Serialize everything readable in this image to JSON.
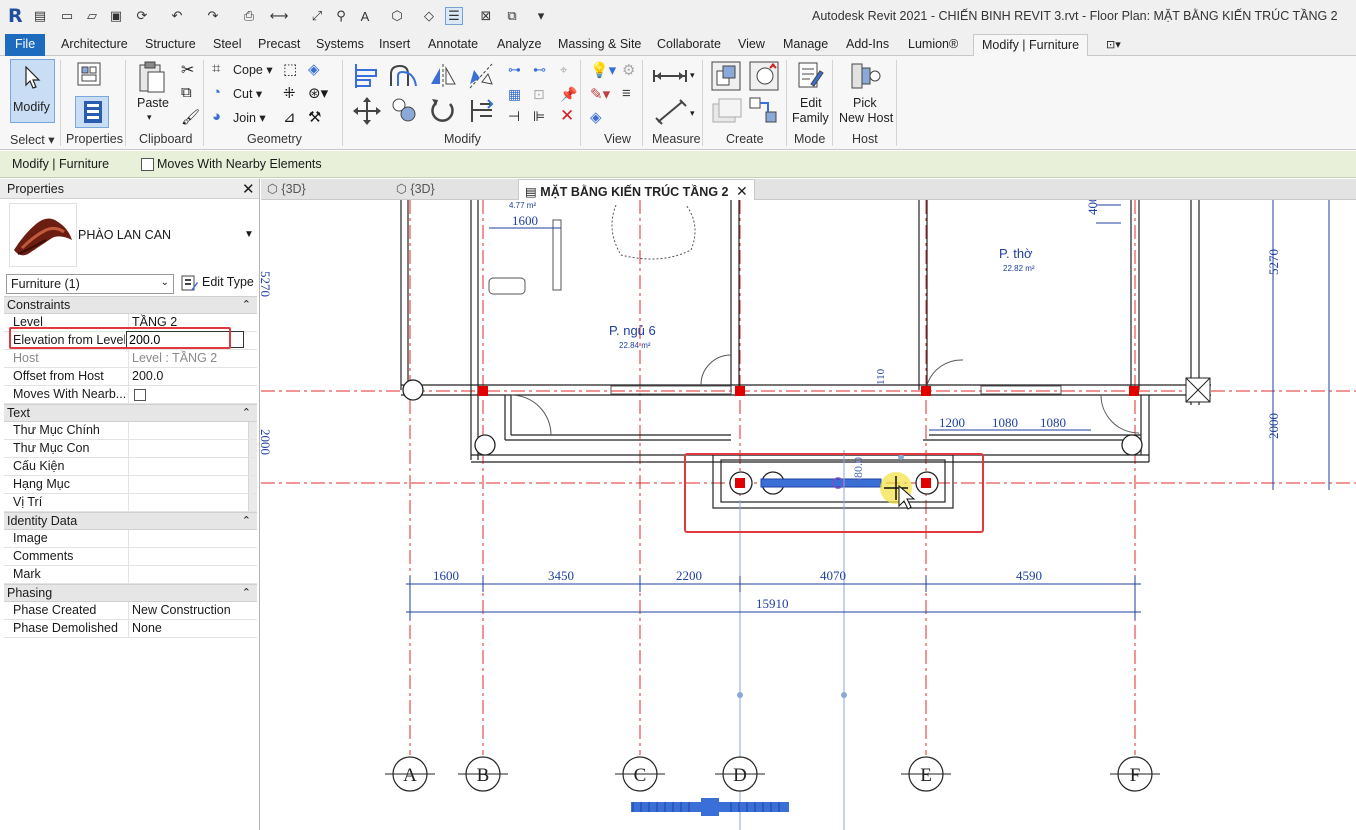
{
  "app": {
    "logo": "R",
    "window_title": "Autodesk Revit 2021 - CHIẾN BINH REVIT 3.rvt - Floor Plan: MẶT BẰNG KIẾN TRÚC TẦNG 2"
  },
  "ribbon_tabs": [
    "File",
    "Architecture",
    "Structure",
    "Steel",
    "Precast",
    "Systems",
    "Insert",
    "Annotate",
    "Analyze",
    "Massing & Site",
    "Collaborate",
    "View",
    "Manage",
    "Add-Ins",
    "Lumion®",
    "Modify | Furniture"
  ],
  "ribbon": {
    "modify": "Modify",
    "paste": "Paste",
    "cope": "Cope",
    "cut": "Cut",
    "join": "Join",
    "edit_family": [
      "Edit",
      "Family"
    ],
    "pick_new_host": [
      "Pick",
      "New Host"
    ],
    "panels": {
      "select": "Select",
      "properties": "Properties",
      "clipboard": "Clipboard",
      "geometry": "Geometry",
      "modify": "Modify",
      "view": "View",
      "measure": "Measure",
      "create": "Create",
      "mode": "Mode",
      "host": "Host"
    }
  },
  "options_bar": {
    "context": "Modify | Furniture",
    "moves_with_nearby": "Moves With Nearby Elements",
    "moves_with_nearby_checked": false
  },
  "properties": {
    "title": "Properties",
    "type_name": "PHÀO LAN CAN",
    "instance_filter": "Furniture (1)",
    "edit_type": "Edit Type",
    "groups": {
      "constraints": "Constraints",
      "text": "Text",
      "identity": "Identity Data",
      "phasing": "Phasing"
    },
    "rows": {
      "level": {
        "key": "Level",
        "value": "TẦNG 2"
      },
      "elevation": {
        "key": "Elevation from Level",
        "value": "200.0"
      },
      "host": {
        "key": "Host",
        "value": "Level : TẦNG 2"
      },
      "offset_host": {
        "key": "Offset from Host",
        "value": "200.0"
      },
      "moves_nearby": {
        "key": "Moves With Nearb...",
        "checked": false
      },
      "thu_muc_chinh": {
        "key": "Thư Mục Chính",
        "value": ""
      },
      "thu_muc_con": {
        "key": "Thư Mục Con",
        "value": ""
      },
      "cau_kien": {
        "key": "Cấu Kiện",
        "value": ""
      },
      "hang_muc": {
        "key": "Hạng Mục",
        "value": ""
      },
      "vi_tri": {
        "key": "Vị Trí",
        "value": ""
      },
      "image": {
        "key": "Image",
        "value": ""
      },
      "comments": {
        "key": "Comments",
        "value": ""
      },
      "mark": {
        "key": "Mark",
        "value": ""
      },
      "phase_created": {
        "key": "Phase Created",
        "value": "New Construction"
      },
      "phase_demolished": {
        "key": "Phase Demolished",
        "value": "None"
      }
    }
  },
  "view_tabs": [
    {
      "label": "{3D}",
      "active": false
    },
    {
      "label": "{3D}",
      "active": false
    },
    {
      "label": "MẶT BẰNG KIẾN TRÚC TẦNG 2",
      "active": true
    }
  ],
  "drawing": {
    "rooms": [
      {
        "name": "P. ngủ 6",
        "area": "22.84 m²"
      },
      {
        "name": "P. thờ",
        "area": "22.82 m²"
      }
    ],
    "small_area": "4.77 m²",
    "top_dim": "1600",
    "right_dims": [
      "5270",
      "2000"
    ],
    "left_dims": [
      "5270",
      "2000"
    ],
    "right_door_dims": [
      "1200",
      "1080",
      "1080"
    ],
    "grid_dims": [
      "1600",
      "3450",
      "2200",
      "4070",
      "4590"
    ],
    "total_dim": "15910",
    "temp_dim": "580.0",
    "small_dim_400": "400",
    "small_dim_110": "110",
    "grid_labels": [
      "A",
      "B",
      "C",
      "D",
      "E",
      "F"
    ],
    "colors": {
      "grid_line": "#e02828",
      "dimension": "#1f3fa0",
      "selection": "#3a6fd8",
      "highlight_box": "#e0393e",
      "column": "#e00000"
    }
  }
}
